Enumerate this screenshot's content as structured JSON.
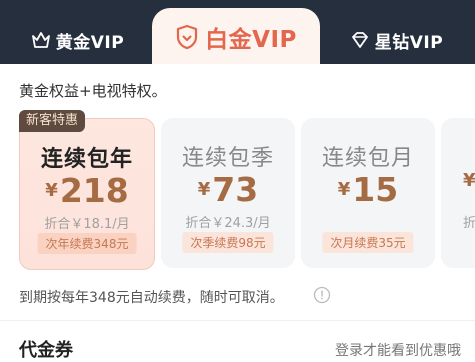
{
  "tabs": [
    {
      "label": "黄金VIP",
      "icon": "crown-icon"
    },
    {
      "label": "白金VIP",
      "icon": "shield-icon"
    },
    {
      "label": "星钻VIP",
      "icon": "diamond-icon"
    }
  ],
  "description": "黄金权益+电视特权。",
  "badge": "新客特惠",
  "plans": [
    {
      "name": "连续包年",
      "currency": "¥",
      "price": "218",
      "per": "折合￥18.1/月",
      "renew": "次年续费348元"
    },
    {
      "name": "连续包季",
      "currency": "¥",
      "price": "73",
      "per": "折合￥24.3/月",
      "renew": "次季续费98元"
    },
    {
      "name": "连续包月",
      "currency": "¥",
      "price": "15",
      "per": "",
      "renew": "次月续费35元"
    },
    {
      "name": "",
      "currency": "¥",
      "price": "",
      "per": "折",
      "renew": ""
    }
  ],
  "note": "到期按每年348元自动续费，随时可取消。",
  "coupon": {
    "title": "代金券",
    "hint": "登录才能看到优惠哦"
  },
  "colors": {
    "accent": "#e4674d",
    "price": "#a56b43",
    "badge_bg": "#5e4a3f",
    "header_bg": "#252f3d"
  }
}
